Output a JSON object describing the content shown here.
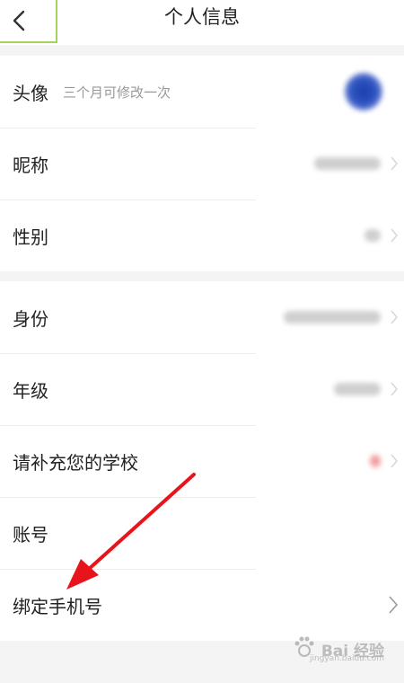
{
  "header": {
    "title": "个人信息",
    "back_icon": "back-arrow-icon"
  },
  "section1": {
    "rows": [
      {
        "label": "头像",
        "hint": "三个月可修改一次"
      },
      {
        "label": "昵称"
      },
      {
        "label": "性别"
      }
    ]
  },
  "section2": {
    "rows": [
      {
        "label": "身份"
      },
      {
        "label": "年级"
      },
      {
        "label": "请补充您的学校"
      },
      {
        "label": "账号"
      },
      {
        "label": "绑定手机号"
      }
    ]
  },
  "watermark": {
    "text": "Bai 经验",
    "sub": "jingyan.baidu.com"
  },
  "colors": {
    "accent_border": "#a6d45a",
    "arrow": "#e8141c",
    "avatar": "#2c52c0"
  }
}
